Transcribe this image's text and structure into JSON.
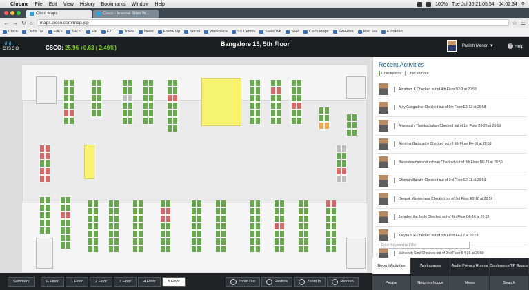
{
  "menubar": {
    "apple": "",
    "items": [
      "Chrome",
      "File",
      "Edit",
      "View",
      "History",
      "Bookmarks",
      "Window",
      "Help"
    ],
    "battery": "100%",
    "clock": "Tue Jul 30 21:05:54",
    "time2": "04:02:34"
  },
  "tabs": [
    {
      "label": "Cisco Maps"
    },
    {
      "label": "Cisco - Internal Sites W..."
    }
  ],
  "address": {
    "url": "maps.cisco.com/map.jsp"
  },
  "bookmarks": [
    "Cisco",
    "Cisco Tax",
    "FdEx",
    "S+CC",
    "Fin",
    "ETC",
    "Travel",
    "News",
    "Follow Up",
    "Social",
    "Workplace",
    "SS Demos",
    "Sales WK",
    "SNP",
    "Cisco Maps",
    "SWAlites",
    "Mac Tax",
    "EuroPlan"
  ],
  "header": {
    "logo_bars": ".ılıılı.",
    "logo_text": "CISCO",
    "ticker_label": "CSCO:",
    "ticker_value": "25.96 +0.63 ( 2.49%)",
    "floor_title": "Bangalore 15, 5th Floor",
    "user": "Pralish Menon",
    "help": "Help"
  },
  "panel": {
    "title": "Recent Activities",
    "legend_in": "Checked In",
    "legend_out": "Checked out",
    "filter_placeholder": "Enter Keyword to Filter",
    "activities": [
      "Abraham K Checked out of 4th Floor D2-3 at 20:59",
      "Ajay Gangadhar Checked out of 5th Floor E3-12 at 20:58",
      "Arunmozhi Thankachalam Checked out of 1st Floor B3-26 at 20:59",
      "Ashritha Ganapathy Checked out of 6th Floor E4-10 at 20:59",
      "Balasubramanian Krishnan Checked out of 5th Floor D6-23 at 20:59",
      "Chaman Barathi Checked out of 3rd Floor E2-11 at 20:59",
      "Deepak Manjeshwar Checked out of 3rd Floor E2-18 at 20:59",
      "Jayadeertha Joshi Checked out of 4th Floor D6-16 at 20:59",
      "Kalyan S R Checked out of 5th Floor E4-12 at 20:59",
      "Maneesh Soni Checked out of 2nd Floor B4-26 at 20:59"
    ]
  },
  "right_tabs": {
    "row1": [
      "Recent Activities",
      "Workspaces",
      "Audio Privacy Rooms",
      "Conference/TP Rooms"
    ],
    "row2": [
      "People",
      "Neighborhoods",
      "News",
      "Search"
    ]
  },
  "floors": [
    "Summary",
    "G Floor",
    "1 Floor",
    "2 Floor",
    "3 Floor",
    "4 Floor",
    "5 Floor"
  ],
  "tools": [
    "Zoom Out",
    "Restore",
    "Zoom In",
    "Refresh"
  ],
  "colors": {
    "available": "#6aa84f",
    "occupied": "#d66a6a",
    "room_booked": "#f7f36e",
    "accent": "#1a5f91"
  }
}
